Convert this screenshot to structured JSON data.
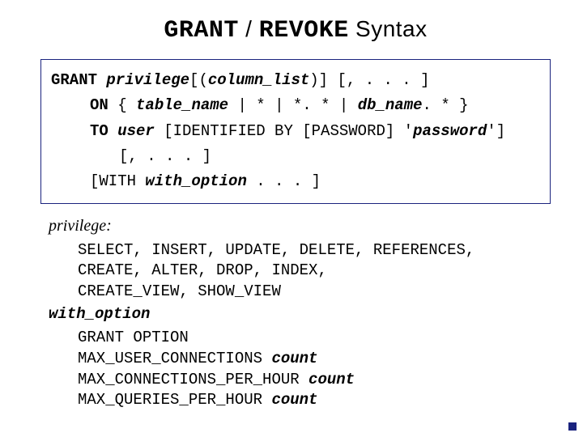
{
  "title": {
    "tt_left": "GRANT",
    "sep": " / ",
    "tt_right": "REVOKE",
    "tail": " Syntax"
  },
  "syntax": {
    "l1": {
      "kw": "GRANT ",
      "em1": "privilege",
      "t1": "[(",
      "em2": "column_list",
      "t2": ")] [, . . . ]"
    },
    "l2": {
      "kw": "ON",
      "t1": " { ",
      "em1": "table_name",
      "t2": " | * | *. * | ",
      "em2": "db_name",
      "t3": ". * }"
    },
    "l3": {
      "kw": "TO ",
      "em1": "user",
      "t1": " [IDENTIFIED BY [PASSWORD] '",
      "em2": "password",
      "t2": "']"
    },
    "l4": {
      "t": "[, . . . ]"
    },
    "l5": {
      "t1": "[WITH ",
      "em1": "with_option",
      "t2": " . . . ]"
    }
  },
  "defs": {
    "priv_hdr": "privilege:",
    "priv_l1": "SELECT, INSERT, UPDATE, DELETE, REFERENCES,",
    "priv_l2": "CREATE, ALTER, DROP, INDEX,",
    "priv_l3": "CREATE_VIEW, SHOW_VIEW",
    "wo_hdr": "with_option",
    "wo_l1": {
      "t": "GRANT OPTION"
    },
    "wo_l2": {
      "t": "MAX_USER_CONNECTIONS ",
      "em": "count"
    },
    "wo_l3": {
      "t": "MAX_CONNECTIONS_PER_HOUR ",
      "em": "count"
    },
    "wo_l4": {
      "t": "MAX_QUERIES_PER_HOUR ",
      "em": "count"
    }
  }
}
